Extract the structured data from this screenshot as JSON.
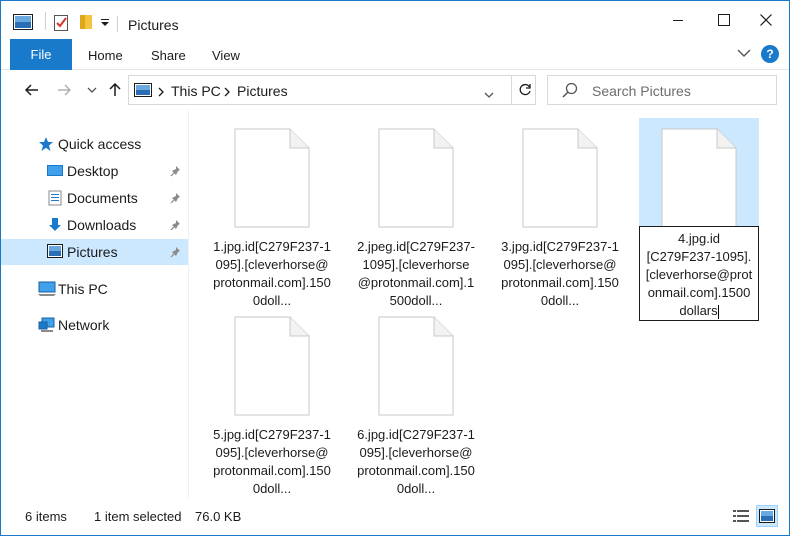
{
  "window": {
    "title": "Pictures",
    "accent": "#1979ca"
  },
  "ribbon": {
    "file_label": "File",
    "home_label": "Home",
    "share_label": "Share",
    "view_label": "View",
    "help_label": "?"
  },
  "address": {
    "this_pc": "This PC",
    "pictures": "Pictures"
  },
  "search": {
    "placeholder": "Search Pictures"
  },
  "sidebar": {
    "quick_access": "Quick access",
    "desktop": "Desktop",
    "documents": "Documents",
    "downloads": "Downloads",
    "pictures": "Pictures",
    "this_pc": "This PC",
    "network": "Network"
  },
  "files": {
    "f1": "1.jpg.id[C279F237-1095].[cleverhorse@protonmail.com].1500doll...",
    "f2": "2.jpeg.id[C279F237-1095].[cleverhorse@protonmail.com].1500doll...",
    "f3": "3.jpg.id[C279F237-1095].[cleverhorse@protonmail.com].1500doll...",
    "f4_l1": "4.jpg.id",
    "f4_l2": "[C279F237-1095].",
    "f4_l3": "[cleverhorse@prot",
    "f4_l4": "onmail.com].1500",
    "f4_l5": "dollars",
    "f5": "5.jpg.id[C279F237-1095].[cleverhorse@protonmail.com].1500doll...",
    "f6": "6.jpg.id[C279F237-1095].[cleverhorse@protonmail.com].1500doll..."
  },
  "status": {
    "items": "6 items",
    "selected": "1 item selected",
    "size": "76.0 KB"
  }
}
